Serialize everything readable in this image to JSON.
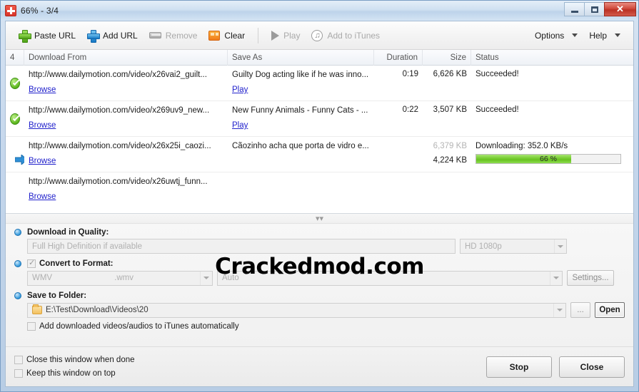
{
  "window": {
    "title": "66% - 3/4",
    "icon": "app-icon",
    "buttons": {
      "minimize": "minimize",
      "maximize": "maximize",
      "close": "✕"
    }
  },
  "toolbar": {
    "items": [
      {
        "label": "Paste URL",
        "icon": "plus-green-icon",
        "disabled": false
      },
      {
        "label": "Add URL",
        "icon": "plus-blue-icon",
        "disabled": false
      },
      {
        "label": "Remove",
        "icon": "remove-icon",
        "disabled": true
      },
      {
        "label": "Clear",
        "icon": "clear-icon",
        "disabled": false
      },
      {
        "label": "Play",
        "icon": "play-icon",
        "disabled": true
      },
      {
        "label": "Add to iTunes",
        "icon": "itunes-icon",
        "disabled": true
      }
    ],
    "options_label": "Options",
    "help_label": "Help"
  },
  "list": {
    "headers": {
      "num": "4",
      "from": "Download From",
      "save_as": "Save As",
      "duration": "Duration",
      "size": "Size",
      "status": "Status"
    },
    "rows": [
      {
        "status_icon": "success-icon",
        "url": "http://www.dailymotion.com/video/x26vai2_guilt...",
        "browse": "Browse",
        "save_as": "Guilty Dog acting like if he was inno...",
        "play": "Play",
        "duration": "0:19",
        "size": "6,626 KB",
        "status": "Succeeded!"
      },
      {
        "status_icon": "success-icon",
        "url": "http://www.dailymotion.com/video/x269uv9_new...",
        "browse": "Browse",
        "save_as": "New Funny Animals - Funny Cats - ...",
        "play": "Play",
        "duration": "0:22",
        "size": "3,507 KB",
        "status": "Succeeded!"
      },
      {
        "status_icon": "downloading-icon",
        "url": "http://www.dailymotion.com/video/x26x25i_caozi...",
        "browse": "Browse",
        "save_as": "Cãozinho acha que porta de vidro e...",
        "play": "",
        "duration": "",
        "size_total": "6,379 KB",
        "size_done": "4,224 KB",
        "status": "Downloading: 352.0 KB/s",
        "progress_percent": 66,
        "progress_label": "66 %"
      },
      {
        "status_icon": "",
        "url": "http://www.dailymotion.com/video/x26uwtj_funn...",
        "browse": "Browse",
        "save_as": "",
        "play": "",
        "duration": "",
        "size": "",
        "status": ""
      }
    ]
  },
  "expander": {
    "icon": "chevron-double-down-icon"
  },
  "settings": {
    "quality": {
      "label": "Download in Quality:",
      "value": "Full High Definition if available",
      "resolution": "HD 1080p"
    },
    "convert": {
      "label": "Convert to Format:",
      "checked": true,
      "format": "WMV",
      "extension": ".wmv",
      "profile": "Auto",
      "settings_button": "Settings..."
    },
    "save_to_folder": {
      "label": "Save to Folder:",
      "path": "E:\\Test\\Download\\Videos\\20",
      "browse_button": "...",
      "open_button": "Open"
    },
    "itunes_checkbox": {
      "label": "Add downloaded videos/audios to iTunes automatically",
      "checked": false
    }
  },
  "bottom": {
    "close_when_done": {
      "label": "Close this window when done",
      "checked": false
    },
    "keep_on_top": {
      "label": "Keep this window on top",
      "checked": false
    },
    "stop_button": "Stop",
    "close_button": "Close"
  },
  "watermark": "Crackedmod.com",
  "colors": {
    "accent_blue": "#3b9ede",
    "progress_green": "#7ace36",
    "link_blue": "#2222cc",
    "close_red": "#cf4a3c"
  }
}
